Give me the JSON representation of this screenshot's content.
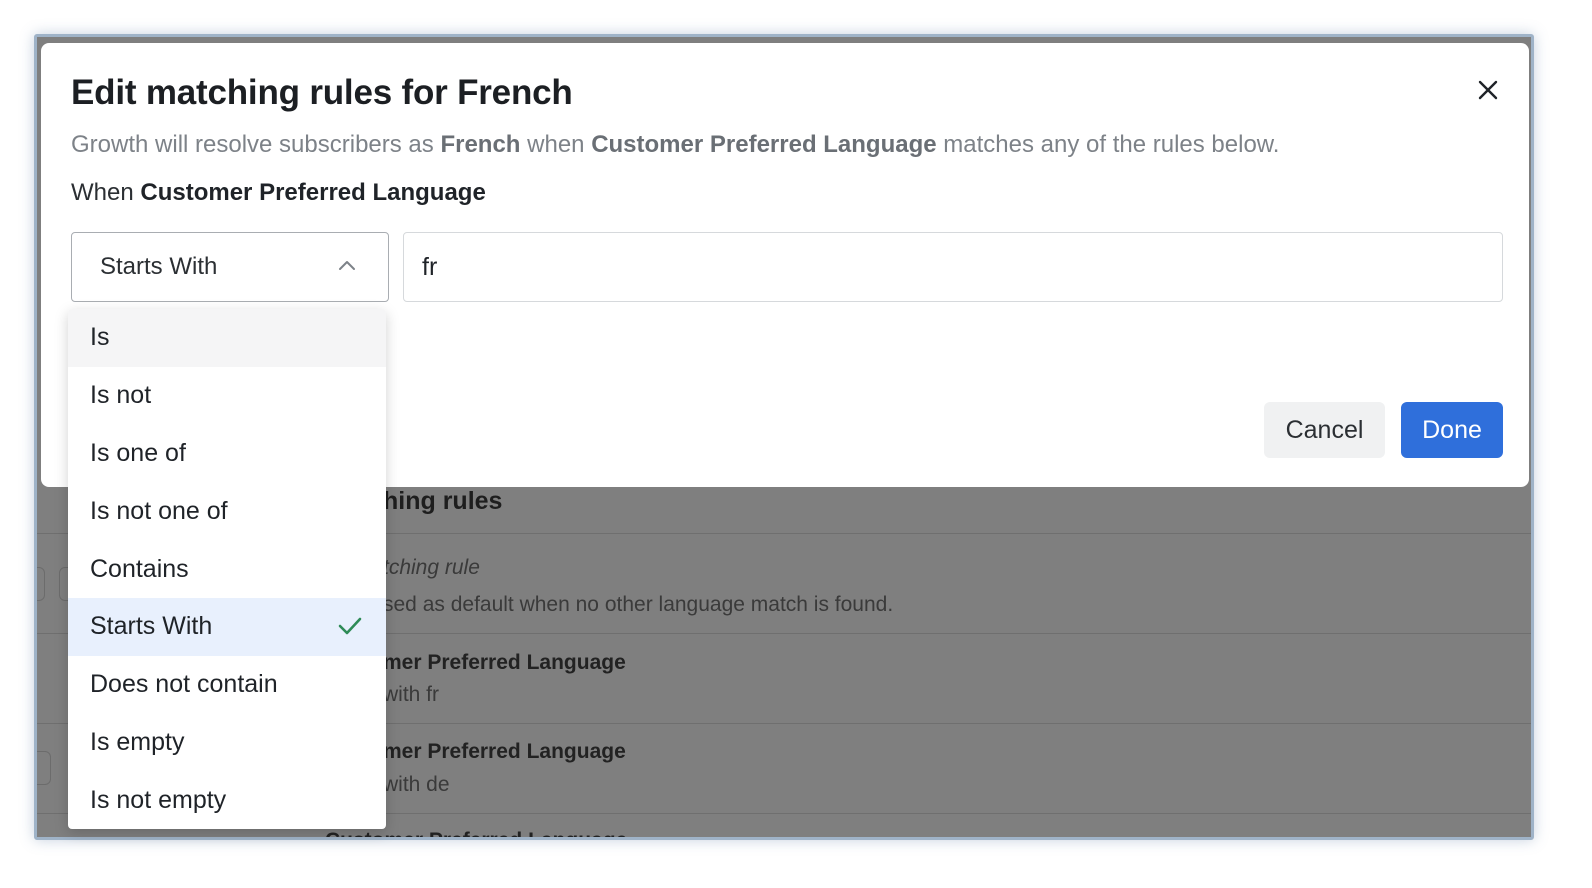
{
  "modal": {
    "title": "Edit matching rules for French",
    "description": {
      "prefix": "Growth will resolve subscribers as ",
      "language": "French",
      "middle": " when ",
      "attribute": "Customer Preferred Language",
      "suffix": " matches any of the rules below."
    },
    "when_label": "When ",
    "when_attribute": "Customer Preferred Language",
    "operator_selected": "Starts With",
    "value": "fr",
    "cancel_label": "Cancel",
    "done_label": "Done",
    "close_icon": "close-icon"
  },
  "dropdown": {
    "options": [
      {
        "label": "Is",
        "state": "hover"
      },
      {
        "label": "Is not",
        "state": ""
      },
      {
        "label": "Is one of",
        "state": ""
      },
      {
        "label": "Is not one of",
        "state": ""
      },
      {
        "label": "Contains",
        "state": ""
      },
      {
        "label": "Starts With",
        "state": "selected"
      },
      {
        "label": "Does not contain",
        "state": ""
      },
      {
        "label": "Is empty",
        "state": ""
      },
      {
        "label": "Is not empty",
        "state": ""
      }
    ],
    "check_icon": "check-icon",
    "check_color": "#2e8b57"
  },
  "background": {
    "section_heading": "hing rules",
    "default_rule_title": "tching rule",
    "default_rule_desc": "sed as default when no other language match is found.",
    "rules": [
      {
        "attribute": "mer Preferred Language",
        "condition": "with fr"
      },
      {
        "attribute": "mer Preferred Language",
        "condition": "with de"
      },
      {
        "attribute": "Customer Preferred Language",
        "condition": ""
      }
    ]
  },
  "colors": {
    "accent": "#2f6fdb",
    "overlay": "#7f7f7f"
  }
}
